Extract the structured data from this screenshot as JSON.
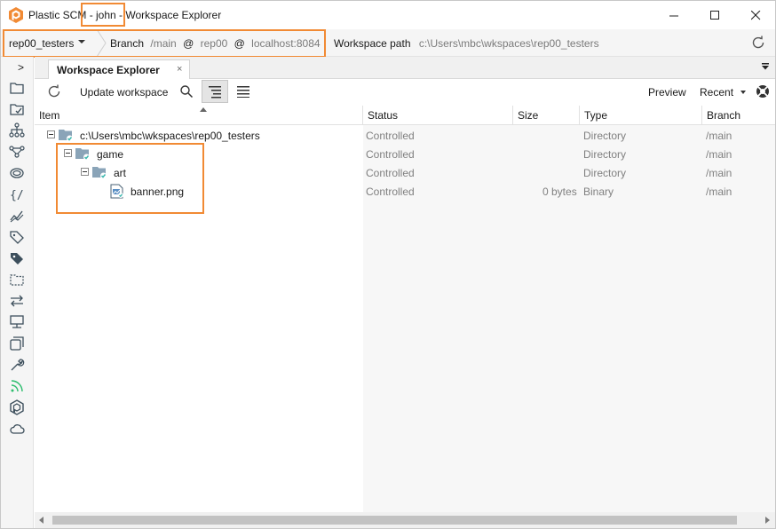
{
  "window": {
    "app_name": "Plastic SCM",
    "user_segment": "- john -",
    "view_name": "Workspace Explorer"
  },
  "location_bar": {
    "repository": "rep00_testers",
    "branch_label": "Branch",
    "branch": "/main",
    "at1": "@",
    "repo": "rep00",
    "at2": "@",
    "server": "localhost:8084",
    "workspace_path_label": "Workspace path",
    "workspace_path": "c:\\Users\\mbc\\wkspaces\\rep00_testers"
  },
  "sidebar": {
    "expand_glyph": ">",
    "icons": [
      "folder-icon",
      "pending-changes-icon",
      "branch-explorer-icon",
      "branches-icon",
      "repositories-icon",
      "code-review-icon",
      "changesets-icon",
      "labels-icon",
      "attributes-icon",
      "shelves-icon",
      "sync-icon",
      "servers-icon",
      "workspaces-icon",
      "tools-icon",
      "live-feed-icon",
      "plastic-logo-icon",
      "cloud-icon"
    ]
  },
  "tabs": [
    {
      "label": "Workspace Explorer",
      "close": "×"
    }
  ],
  "toolbar": {
    "update_workspace": "Update workspace",
    "preview": "Preview",
    "recent": "Recent"
  },
  "columns": [
    "Item",
    "Status",
    "Size",
    "Type",
    "Branch"
  ],
  "rows": [
    {
      "name": "c:\\Users\\mbc\\wkspaces\\rep00_testers",
      "status": "Controlled",
      "size": "",
      "type": "Directory",
      "branch": "/main"
    },
    {
      "name": "game",
      "status": "Controlled",
      "size": "",
      "type": "Directory",
      "branch": "/main"
    },
    {
      "name": "art",
      "status": "Controlled",
      "size": "",
      "type": "Directory",
      "branch": "/main"
    },
    {
      "name": "banner.png",
      "status": "Controlled",
      "size": "0 bytes",
      "type": "Binary",
      "branch": "/main"
    }
  ],
  "colors": {
    "accent_highlight": "#f18a34",
    "folder": "#8aa4b8",
    "controlled_check": "#3cb8b0",
    "live_feed": "#2dbd6e"
  }
}
